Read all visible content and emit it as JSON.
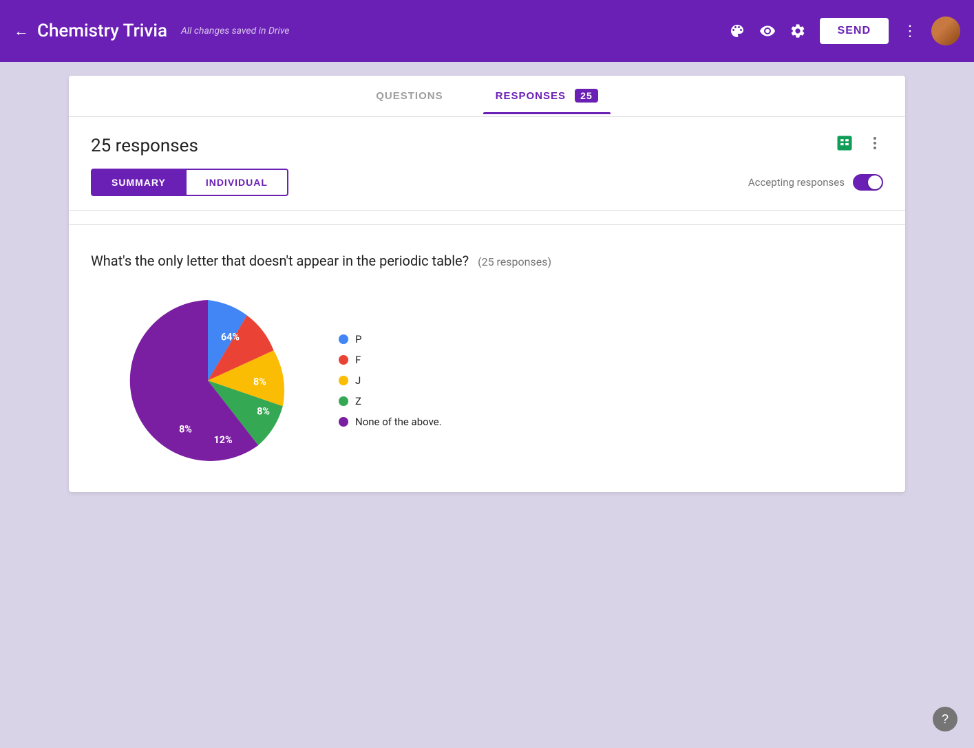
{
  "header": {
    "back_label": "←",
    "title": "Chemistry Trivia",
    "saved_status": "All changes saved in Drive",
    "send_label": "SEND",
    "palette_icon": "palette",
    "eye_icon": "eye",
    "gear_icon": "gear",
    "more_icon": "⋮"
  },
  "tabs": {
    "questions_label": "QUESTIONS",
    "responses_label": "RESPONSES",
    "response_count_badge": "25"
  },
  "responses": {
    "count_label": "25 responses",
    "view_summary": "SUMMARY",
    "view_individual": "INDIVIDUAL",
    "accepting_label": "Accepting responses"
  },
  "question": {
    "text": "What's the only letter that doesn't appear in the periodic table?",
    "response_count": "(25 responses)"
  },
  "chart": {
    "slices": [
      {
        "label": "P",
        "value": 8,
        "color": "#4285f4",
        "start_angle": 0,
        "end_angle": 28.8
      },
      {
        "label": "F",
        "value": 8,
        "color": "#ea4335",
        "start_angle": 28.8,
        "end_angle": 57.6
      },
      {
        "label": "J",
        "value": 12,
        "color": "#fbbc04",
        "start_angle": 57.6,
        "end_angle": 100.8
      },
      {
        "label": "Z",
        "value": 8,
        "color": "#34a853",
        "start_angle": 100.8,
        "end_angle": 129.6
      },
      {
        "label": "None of the above.",
        "value": 64,
        "color": "#7b1fa2",
        "start_angle": 129.6,
        "end_angle": 360
      }
    ],
    "legend": [
      {
        "label": "P",
        "color": "#4285f4"
      },
      {
        "label": "F",
        "color": "#ea4335"
      },
      {
        "label": "J",
        "color": "#fbbc04"
      },
      {
        "label": "Z",
        "color": "#34a853"
      },
      {
        "label": "None of the above.",
        "color": "#7b1fa2"
      }
    ]
  },
  "help": {
    "label": "?"
  }
}
